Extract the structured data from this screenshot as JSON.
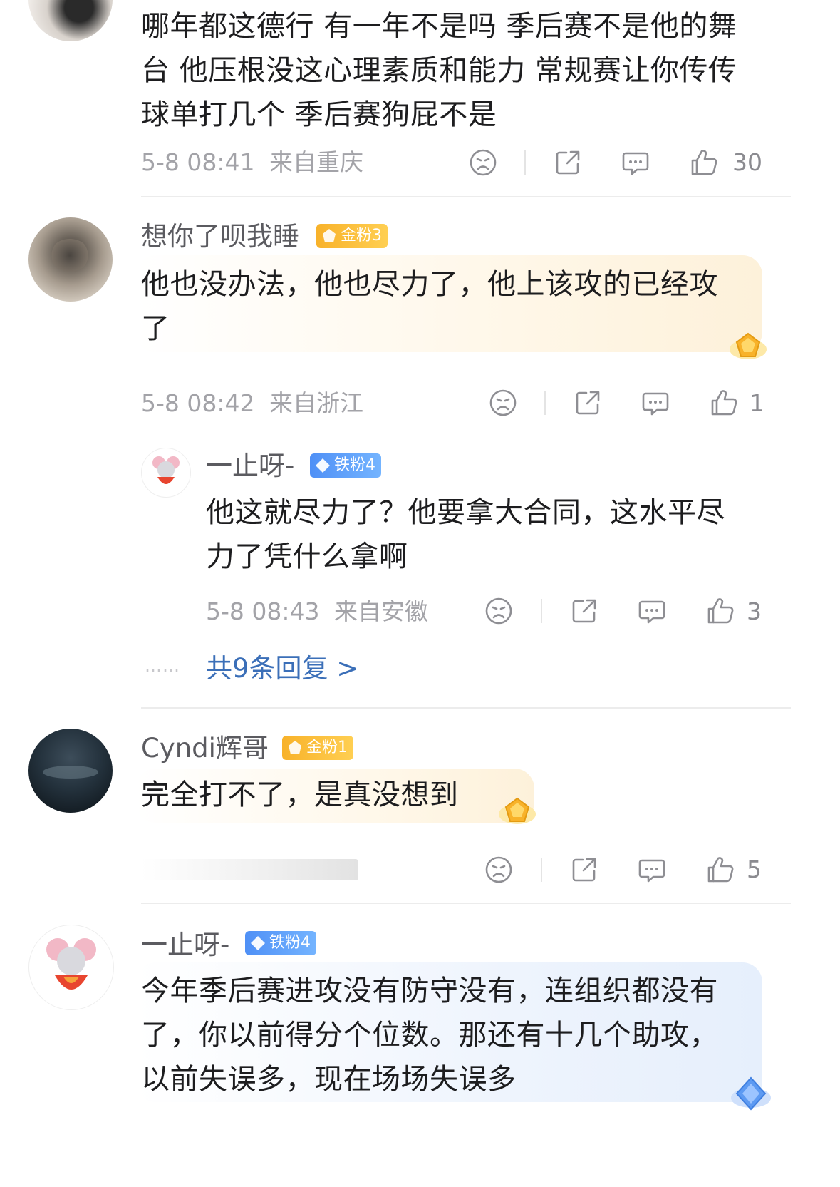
{
  "comments": [
    {
      "text_lines": [
        "哪年都这德行 有一年不是吗 季后赛不是他的舞",
        "台 他压根没这心理素质和能力 常规赛让你传传",
        "球单打几个 季后赛狗屁不是"
      ],
      "time": "5-8 08:41",
      "location": "来自重庆",
      "likes": "30"
    },
    {
      "username": "想你了呗我睡",
      "badge": "金粉3",
      "text_lines": [
        "他也没办法，他也尽力了，他上该攻的已经攻",
        "了"
      ],
      "time": "5-8 08:42",
      "location": "来自浙江",
      "likes": "1",
      "reply": {
        "username": "一止呀-",
        "badge": "铁粉4",
        "text_lines": [
          "他这就尽力了？他要拿大合同，这水平尽",
          "力了凭什么拿啊"
        ],
        "time": "5-8 08:43",
        "location": "来自安徽",
        "likes": "3"
      },
      "more_replies": "共9条回复 >",
      "more_dots": "……"
    },
    {
      "username": "Cyndi辉哥",
      "badge": "金粉1",
      "text_lines": [
        "完全打不了，是真没想到"
      ],
      "likes": "5"
    },
    {
      "username": "一止呀-",
      "badge": "铁粉4",
      "text_lines": [
        "今年季后赛进攻没有防守没有，连组织都没有",
        "了，你以前得分个位数。那还有十几个助攻，",
        "以前失误多，现在场场失误多"
      ]
    }
  ],
  "icons": [
    "sad-face-icon",
    "share-icon",
    "comment-icon",
    "like-icon",
    "diamond-icon"
  ],
  "colors": {
    "gold_badge": "#f8b22a",
    "iron_badge": "#4f90f6",
    "link": "#3b6fb8",
    "meta": "#a3a3a8"
  }
}
